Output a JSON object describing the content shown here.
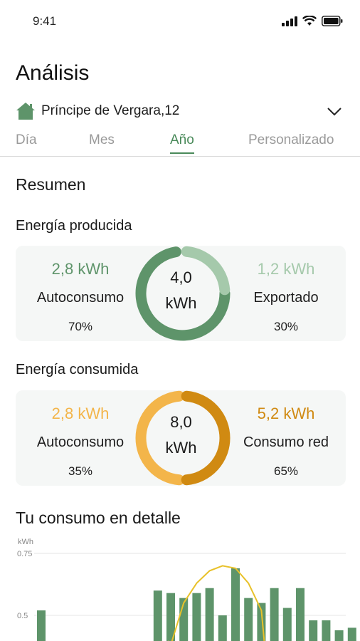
{
  "status": {
    "time": "9:41"
  },
  "title": "Análisis",
  "address": {
    "text": "Príncipe de Vergara,12"
  },
  "tabs": [
    {
      "label": "Día"
    },
    {
      "label": "Mes"
    },
    {
      "label": "Año"
    },
    {
      "label": "Personalizado"
    }
  ],
  "summary": {
    "title": "Resumen",
    "produced": {
      "title": "Energía producida",
      "total_value": "4,0",
      "total_unit": "kWh",
      "left": {
        "value": "2,8 kWh",
        "label": "Autoconsumo",
        "pct": "70%"
      },
      "right": {
        "value": "1,2 kWh",
        "label": "Exportado",
        "pct": "30%"
      },
      "colors": {
        "left": "#5e946a",
        "right": "#a5c9ab"
      }
    },
    "consumed": {
      "title": "Energía consumida",
      "total_value": "8,0",
      "total_unit": "kWh",
      "left": {
        "value": "2,8 kWh",
        "label": "Autoconsumo",
        "pct": "35%"
      },
      "right": {
        "value": "5,2 kWh",
        "label": "Consumo red",
        "pct": "65%"
      },
      "colors": {
        "left": "#f3b54a",
        "right": "#d08a12"
      }
    }
  },
  "detail": {
    "title": "Tu consumo en detalle",
    "unit": "kWh",
    "ticks": [
      "0.75",
      "0.5"
    ]
  },
  "chart_data": {
    "type": "bar",
    "ylabel": "kWh",
    "ylim": [
      0.25,
      0.75
    ],
    "values": [
      0.52,
      0,
      0,
      0,
      0,
      0,
      0,
      0,
      0,
      0.6,
      0.59,
      0.57,
      0.59,
      0.61,
      0.5,
      0.69,
      0.57,
      0.55,
      0.61,
      0.53,
      0.61,
      0.48,
      0.48,
      0.44,
      0.45
    ],
    "line": [
      0,
      0,
      0,
      0,
      0,
      0,
      0,
      0,
      0,
      0,
      0.38,
      0.55,
      0.63,
      0.68,
      0.7,
      0.69,
      0.63,
      0.52,
      0,
      0,
      0,
      0,
      0,
      0,
      0
    ],
    "colors": {
      "bar": "#5e946a",
      "line": "#e8c12a"
    }
  }
}
